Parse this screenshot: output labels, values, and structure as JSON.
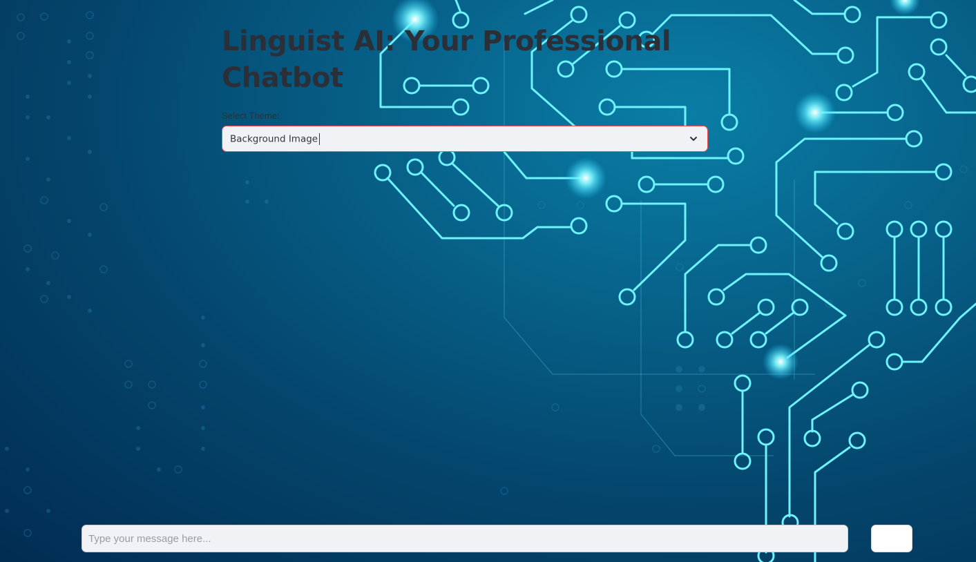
{
  "app": {
    "title": "Linguist AI: Your Professional Chatbot"
  },
  "theme_select": {
    "label": "Select Theme:",
    "selected": "Background Image"
  },
  "chat": {
    "placeholder": "Type your message here...",
    "send_label": ""
  },
  "colors": {
    "background_dark": "#022c52",
    "background_mid": "#07628a",
    "circuit": "#6ff3ff",
    "title_text": "#2b3038",
    "input_bg": "#f0f2f6",
    "focus_border": "#ff4b4b"
  },
  "icons": {
    "dropdown": "chevron-down-icon",
    "background": "circuit-board-image"
  }
}
